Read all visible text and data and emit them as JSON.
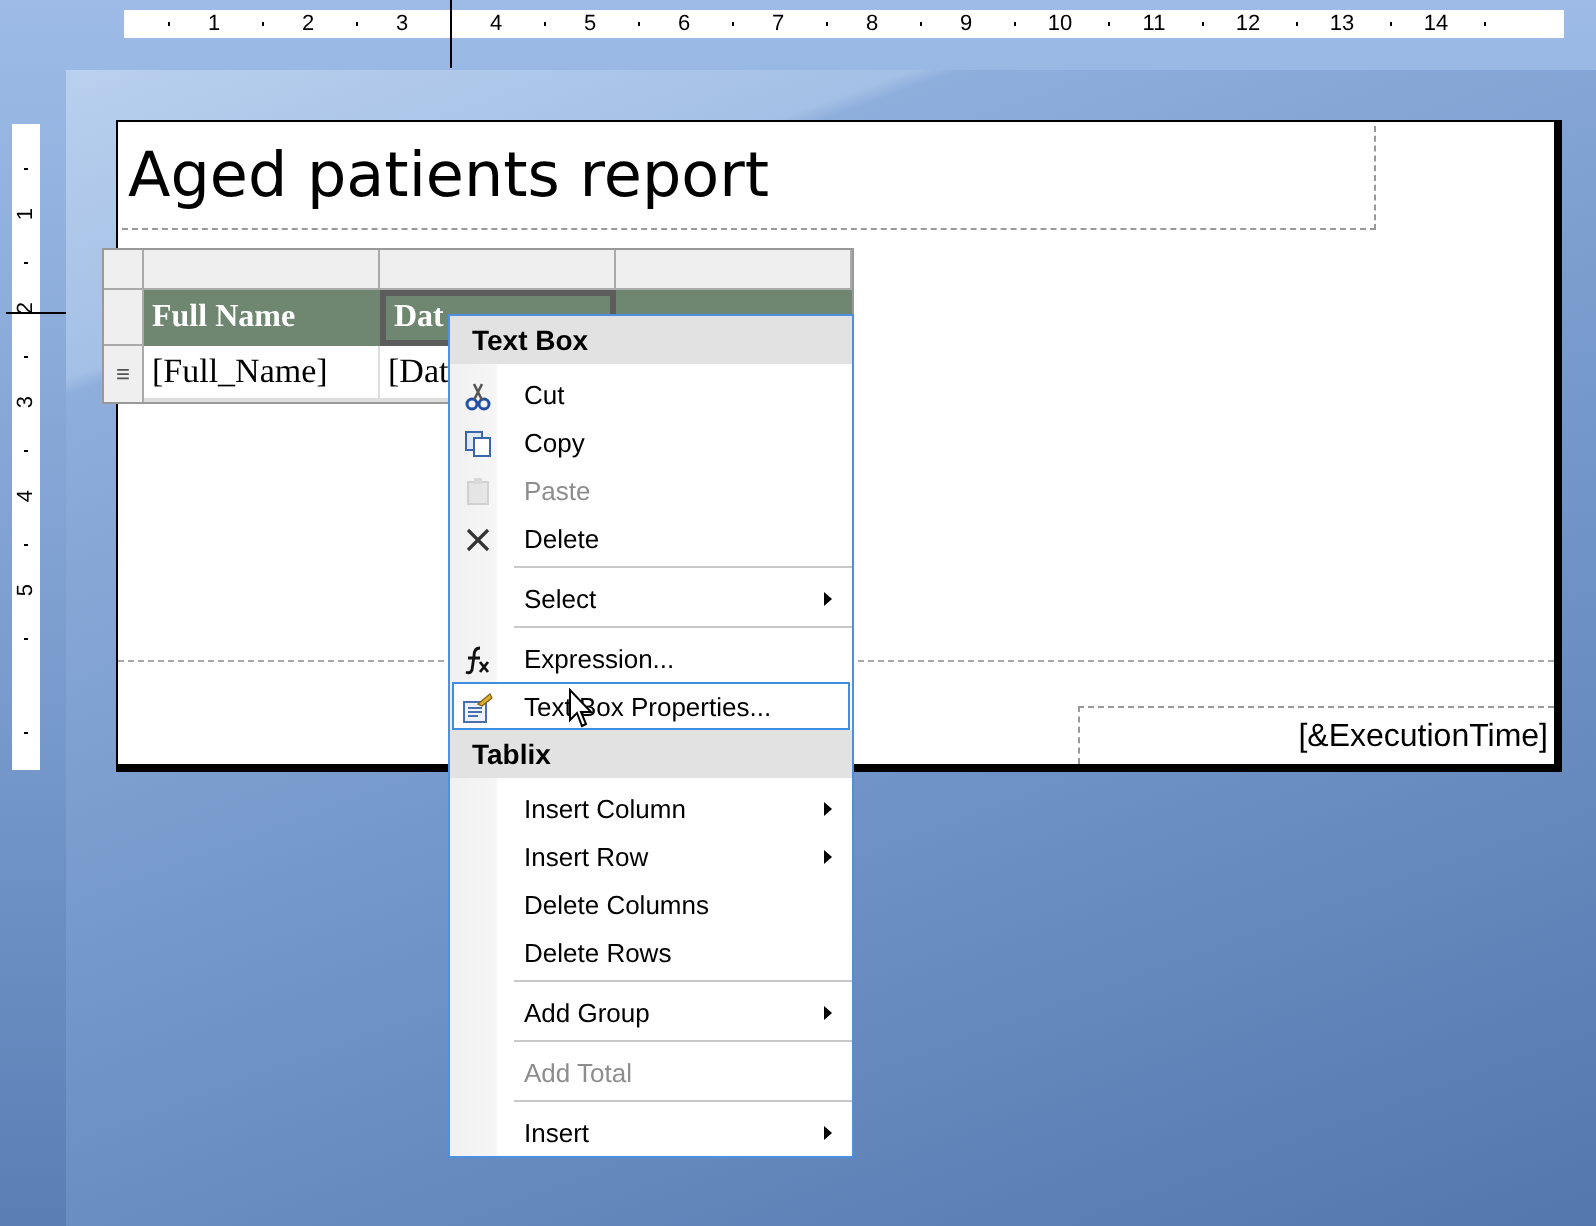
{
  "ruler_top": {
    "labels": [
      "1",
      "2",
      "3",
      "4",
      "5",
      "6",
      "7",
      "8",
      "9",
      "10",
      "11",
      "12",
      "13",
      "14"
    ]
  },
  "ruler_left": {
    "labels": [
      "1",
      "2",
      "3",
      "4",
      "5"
    ]
  },
  "report": {
    "title": "Aged patients report",
    "table": {
      "header": [
        {
          "text": "Full Name",
          "selected": false
        },
        {
          "text": "Dat",
          "selected": true
        },
        {
          "selected": false
        }
      ],
      "detail": [
        {
          "text": "[Full_Name]"
        },
        {
          "text": "[Dat"
        }
      ],
      "row_handle": "≡"
    },
    "footer": {
      "text": "[&ExecutionTime]"
    }
  },
  "menu": {
    "sections": [
      {
        "title": "Text Box",
        "items": [
          {
            "kind": "item",
            "label": "Cut",
            "disabled": false,
            "submenu": false,
            "selected": false
          },
          {
            "kind": "item",
            "label": "Copy",
            "disabled": false,
            "submenu": false,
            "selected": false
          },
          {
            "kind": "item",
            "label": "Paste",
            "disabled": true,
            "submenu": false,
            "selected": false
          },
          {
            "kind": "item",
            "label": "Delete",
            "disabled": false,
            "submenu": false,
            "selected": false
          },
          {
            "kind": "separator"
          },
          {
            "kind": "item",
            "label": "Select",
            "disabled": false,
            "submenu": true,
            "selected": false
          },
          {
            "kind": "separator"
          },
          {
            "kind": "item",
            "label": "Expression...",
            "disabled": false,
            "submenu": false,
            "selected": false
          },
          {
            "kind": "item",
            "label": "Text Box Properties...",
            "disabled": false,
            "submenu": false,
            "selected": true
          }
        ]
      },
      {
        "title": "Tablix",
        "items": [
          {
            "kind": "item",
            "label": "Insert Column",
            "disabled": false,
            "submenu": true,
            "selected": false
          },
          {
            "kind": "item",
            "label": "Insert Row",
            "disabled": false,
            "submenu": true,
            "selected": false
          },
          {
            "kind": "item",
            "label": "Delete Columns",
            "disabled": false,
            "submenu": false,
            "selected": false
          },
          {
            "kind": "item",
            "label": "Delete Rows",
            "disabled": false,
            "submenu": false,
            "selected": false
          },
          {
            "kind": "separator"
          },
          {
            "kind": "item",
            "label": "Add Group",
            "disabled": false,
            "submenu": true,
            "selected": false
          },
          {
            "kind": "separator"
          },
          {
            "kind": "item",
            "label": "Add Total",
            "disabled": true,
            "submenu": false,
            "selected": false
          },
          {
            "kind": "separator"
          },
          {
            "kind": "item",
            "label": "Insert",
            "disabled": false,
            "submenu": true,
            "selected": false
          }
        ]
      }
    ]
  }
}
